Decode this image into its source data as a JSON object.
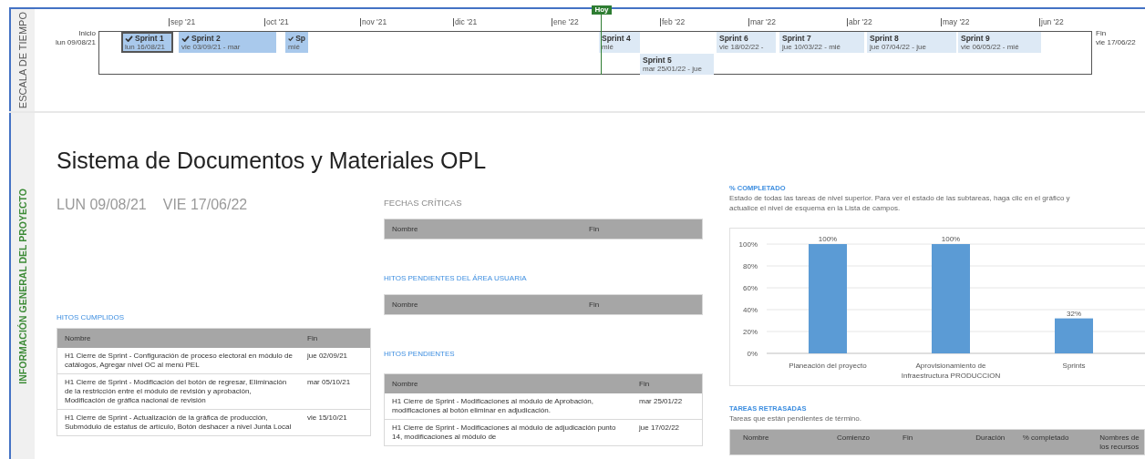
{
  "timeline": {
    "label": "ESCALA DE TIEMPO",
    "today": "Hoy",
    "start": {
      "label": "Inicio",
      "date": "lun 09/08/21"
    },
    "end": {
      "label": "Fin",
      "date": "vie 17/06/22"
    },
    "months": [
      "sep '21",
      "oct '21",
      "nov '21",
      "dic '21",
      "ene '22",
      "feb '22",
      "mar '22",
      "abr '22",
      "may '22",
      "jun '22"
    ],
    "sprints": [
      {
        "name": "Sprint 1",
        "dates": "lun 16/08/21",
        "completed": true,
        "selected": true
      },
      {
        "name": "Sprint 2",
        "dates": "vie 03/09/21 - mar",
        "completed": true,
        "selected": false
      },
      {
        "name": "Sp",
        "dates": "mié",
        "completed": true,
        "selected": false
      },
      {
        "name": "Sprint 4",
        "dates": "mié",
        "completed": false,
        "selected": false
      },
      {
        "name": "Sprint 5",
        "dates": "mar 25/01/22 - jue",
        "completed": false,
        "selected": false
      },
      {
        "name": "Sprint 6",
        "dates": "vie 18/02/22 -",
        "completed": false,
        "selected": false
      },
      {
        "name": "Sprint 7",
        "dates": "jue 10/03/22 - mié",
        "completed": false,
        "selected": false
      },
      {
        "name": "Sprint 8",
        "dates": "jue 07/04/22 - jue",
        "completed": false,
        "selected": false
      },
      {
        "name": "Sprint 9",
        "dates": "vie 06/05/22 - mié",
        "completed": false,
        "selected": false
      }
    ]
  },
  "overview": {
    "label": "INFORMACIÓN GENERAL DEL PROYECTO",
    "title": "Sistema de Documentos y Materiales OPL",
    "start_date": "LUN 09/08/21",
    "end_date": "VIE 17/06/22",
    "milestones_done": {
      "title": "HITOS CUMPLIDOS",
      "columns": [
        "Nombre",
        "Fin"
      ],
      "rows": [
        {
          "name": "H1 Cierre de Sprint - Configuración de proceso electoral en módulo de catálogos, Agregar nivel OC al menú PEL",
          "end": "jue 02/09/21"
        },
        {
          "name": "H1 Cierre de Sprint - Modificación del botón de regresar, Eliminación de la restricción entre el módulo de revisión y aprobación, Modificación de gráfica nacional de revisión",
          "end": "mar 05/10/21"
        },
        {
          "name": "H1 Cierre de Sprint - Actualización de la gráfica de producción, Submódulo de estatus de artículo, Botón deshacer a nivel Junta Local",
          "end": "vie 15/10/21"
        }
      ]
    },
    "critical_dates": {
      "title": "FECHAS CRÍTICAS",
      "columns": [
        "Nombre",
        "Fin"
      ]
    },
    "user_area_milestones": {
      "title": "HITOS PENDIENTES DEL ÁREA USUARIA",
      "columns": [
        "Nombre",
        "Fin"
      ]
    },
    "pending_milestones": {
      "title": "HITOS PENDIENTES",
      "columns": [
        "Nombre",
        "Fin"
      ],
      "rows": [
        {
          "name": "H1 Cierre de Sprint - Modificaciones al módulo de Aprobación, modificaciones al botón eliminar en adjudicación.",
          "end": "mar 25/01/22"
        },
        {
          "name": "H1 Cierre de Sprint - Modificaciones al módulo de adjudicación punto 14, modificaciones al módulo de",
          "end": "jue 17/02/22"
        }
      ]
    },
    "percent_complete": {
      "title": "% COMPLETADO",
      "description": "Estado de todas las tareas de nivel superior. Para ver el estado de las subtareas, haga clic en el gráfico y actualice el nivel de esquema en la Lista de campos.",
      "chart_data": {
        "type": "bar",
        "grid": true,
        "categories": [
          "Planeación del proyecto",
          "Aprovisionamiento de Infraestructura PRODUCCION",
          "Sprints"
        ],
        "values": [
          100,
          100,
          32
        ],
        "ylim": [
          0,
          100
        ],
        "yticks": [
          {
            "value": 0,
            "label": "0%"
          },
          {
            "value": 20,
            "label": "20%"
          },
          {
            "value": 40,
            "label": "40%"
          },
          {
            "value": 60,
            "label": "60%"
          },
          {
            "value": 80,
            "label": "80%"
          },
          {
            "value": 100,
            "label": "100%"
          }
        ],
        "value_labels": [
          "100%",
          "100%",
          "32%"
        ]
      }
    },
    "late_tasks": {
      "title": "TAREAS RETRASADAS",
      "description": "Tareas que están pendientes de término.",
      "columns": [
        "Nombre",
        "Comienzo",
        "Fin",
        "Duración",
        "% completado",
        "Nombres de los recursos"
      ]
    }
  }
}
